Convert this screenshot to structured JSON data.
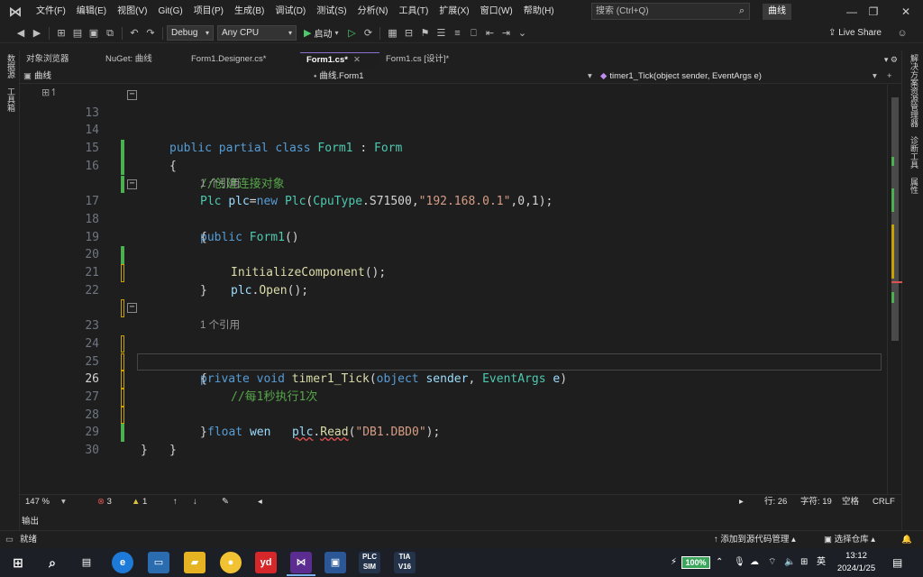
{
  "app": {
    "logo": "visual-studio-logo",
    "menu": [
      "文件(F)",
      "编辑(E)",
      "视图(V)",
      "Git(G)",
      "项目(P)",
      "生成(B)",
      "调试(D)",
      "测试(S)",
      "分析(N)",
      "工具(T)",
      "扩展(X)",
      "窗口(W)",
      "帮助(H)"
    ],
    "search_placeholder": "搜索 (Ctrl+Q)",
    "solution_name": "曲线",
    "live_share": "Live Share"
  },
  "toolbar": {
    "config": "Debug",
    "platform": "Any CPU",
    "run_label": "启动"
  },
  "left_strip": [
    "数据源",
    "工具箱"
  ],
  "right_strip": [
    "解决方案资源管理器",
    "诊断工具",
    "属性"
  ],
  "tabs": [
    {
      "label": "对象浏览器",
      "active": false,
      "closable": false
    },
    {
      "label": "NuGet: 曲线",
      "active": false,
      "closable": false
    },
    {
      "label": "Form1.Designer.cs*",
      "active": false,
      "closable": false
    },
    {
      "label": "Form1.cs*",
      "active": true,
      "closable": true
    },
    {
      "label": "Form1.cs [设计]*",
      "active": false,
      "closable": false
    }
  ],
  "navbar": {
    "project": "曲线",
    "class": "曲线.Form1",
    "member": "timer1_Tick(object sender, EventArgs e)"
  },
  "editor": {
    "codelens_text": "1 个引用",
    "lines": {
      "l13": "13",
      "l14": "14",
      "l15": "15",
      "l16": "16",
      "l17": "17",
      "l18": "18",
      "l19": "19",
      "l20": "20",
      "l21": "21",
      "l22": "22",
      "l23": "23",
      "l24": "24",
      "l25": "25",
      "l26": "26",
      "l27": "27",
      "l28": "28",
      "l29": "29",
      "l30": "30"
    },
    "comment_create": "//创建连接对象",
    "comment_tick": "//每1秒执行1次",
    "plc_ip": "\"192.168.0.1\"",
    "read_address": "\"DB1.DBD0\""
  },
  "editor_status": {
    "zoom": "147 %",
    "errors": "3",
    "warnings": "1",
    "line": "行: 26",
    "col": "字符: 19",
    "whitespace": "空格",
    "eol": "CRLF"
  },
  "output_tab": "输出",
  "statusbar": {
    "ready": "就绪",
    "source_control": "添加到源代码管理",
    "repo": "选择仓库"
  },
  "taskbar": {
    "battery": "100%",
    "ime": "英",
    "time": "13:12",
    "date": "2024/1/25"
  },
  "colors": {
    "editor_bg": "#1e1e1e",
    "keyword": "#569cd6",
    "type": "#4ec9b0",
    "comment": "#57a64a",
    "string": "#d69d85"
  }
}
